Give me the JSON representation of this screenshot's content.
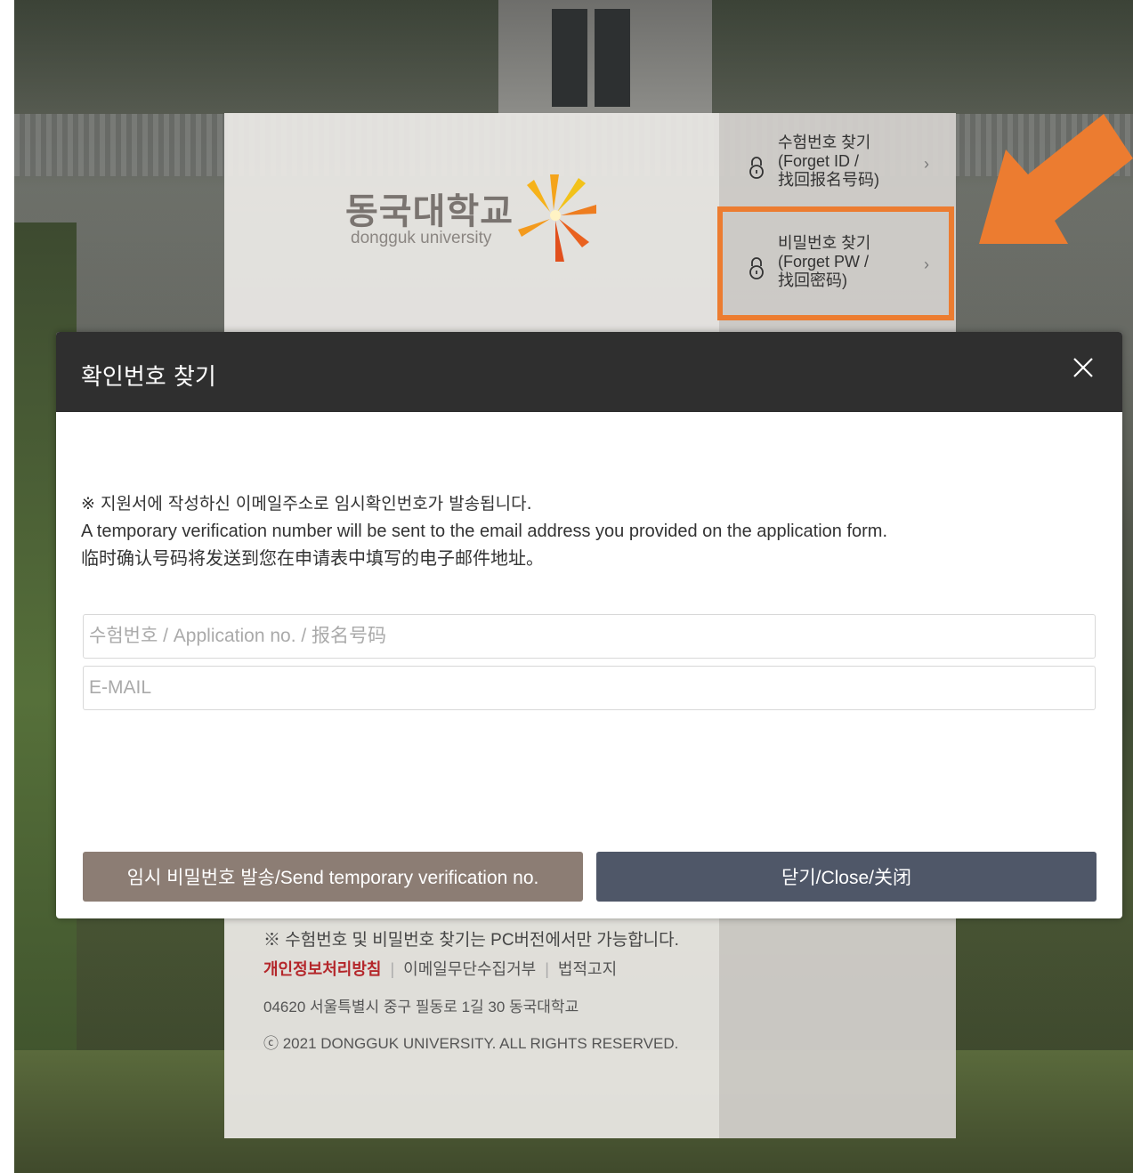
{
  "login_page": {
    "logo": {
      "name_ko": "동국대학교",
      "name_en": "dongguk university"
    },
    "find_links": [
      {
        "line1": "수험번호 찾기",
        "line2": "(Forget ID /",
        "line3": "找回报名号码)"
      },
      {
        "line1": "비밀번호 찾기",
        "line2": "(Forget PW /",
        "line3": "找回密码)"
      }
    ],
    "footer": {
      "note": "※ 수험번호 및 비밀번호 찾기는 PC버전에서만 가능합니다.",
      "links": [
        "개인정보처리방침",
        "이메일무단수집거부",
        "법적고지"
      ],
      "address": "04620 서울특별시 중구 필동로 1길 30 동국대학교",
      "copyright": "ⓒ 2021 DONGGUK UNIVERSITY. ALL RIGHTS RESERVED."
    }
  },
  "annotation": {
    "highlight_color": "#ec7c30"
  },
  "modal": {
    "title": "확인번호 찾기",
    "close_icon": "close-icon",
    "messages": {
      "ko": "※ 지원서에 작성하신 이메일주소로 임시확인번호가 발송됩니다.",
      "en": "A temporary verification number will be sent to the email address you provided on the application form.",
      "zh": "临时确认号码将发送到您在申请表中填写的电子邮件地址。"
    },
    "fields": {
      "application_no": {
        "value": "",
        "placeholder": "수험번호 / Application no. / 报名号码"
      },
      "email": {
        "value": "",
        "placeholder": "E-MAIL"
      }
    },
    "buttons": {
      "send": "임시 비밀번호 발송/Send temporary verification no.",
      "close": "닫기/Close/关闭"
    },
    "colors": {
      "header": "#2f2f2f",
      "send_button": "#8c7d74",
      "close_button": "#4f5768"
    }
  }
}
